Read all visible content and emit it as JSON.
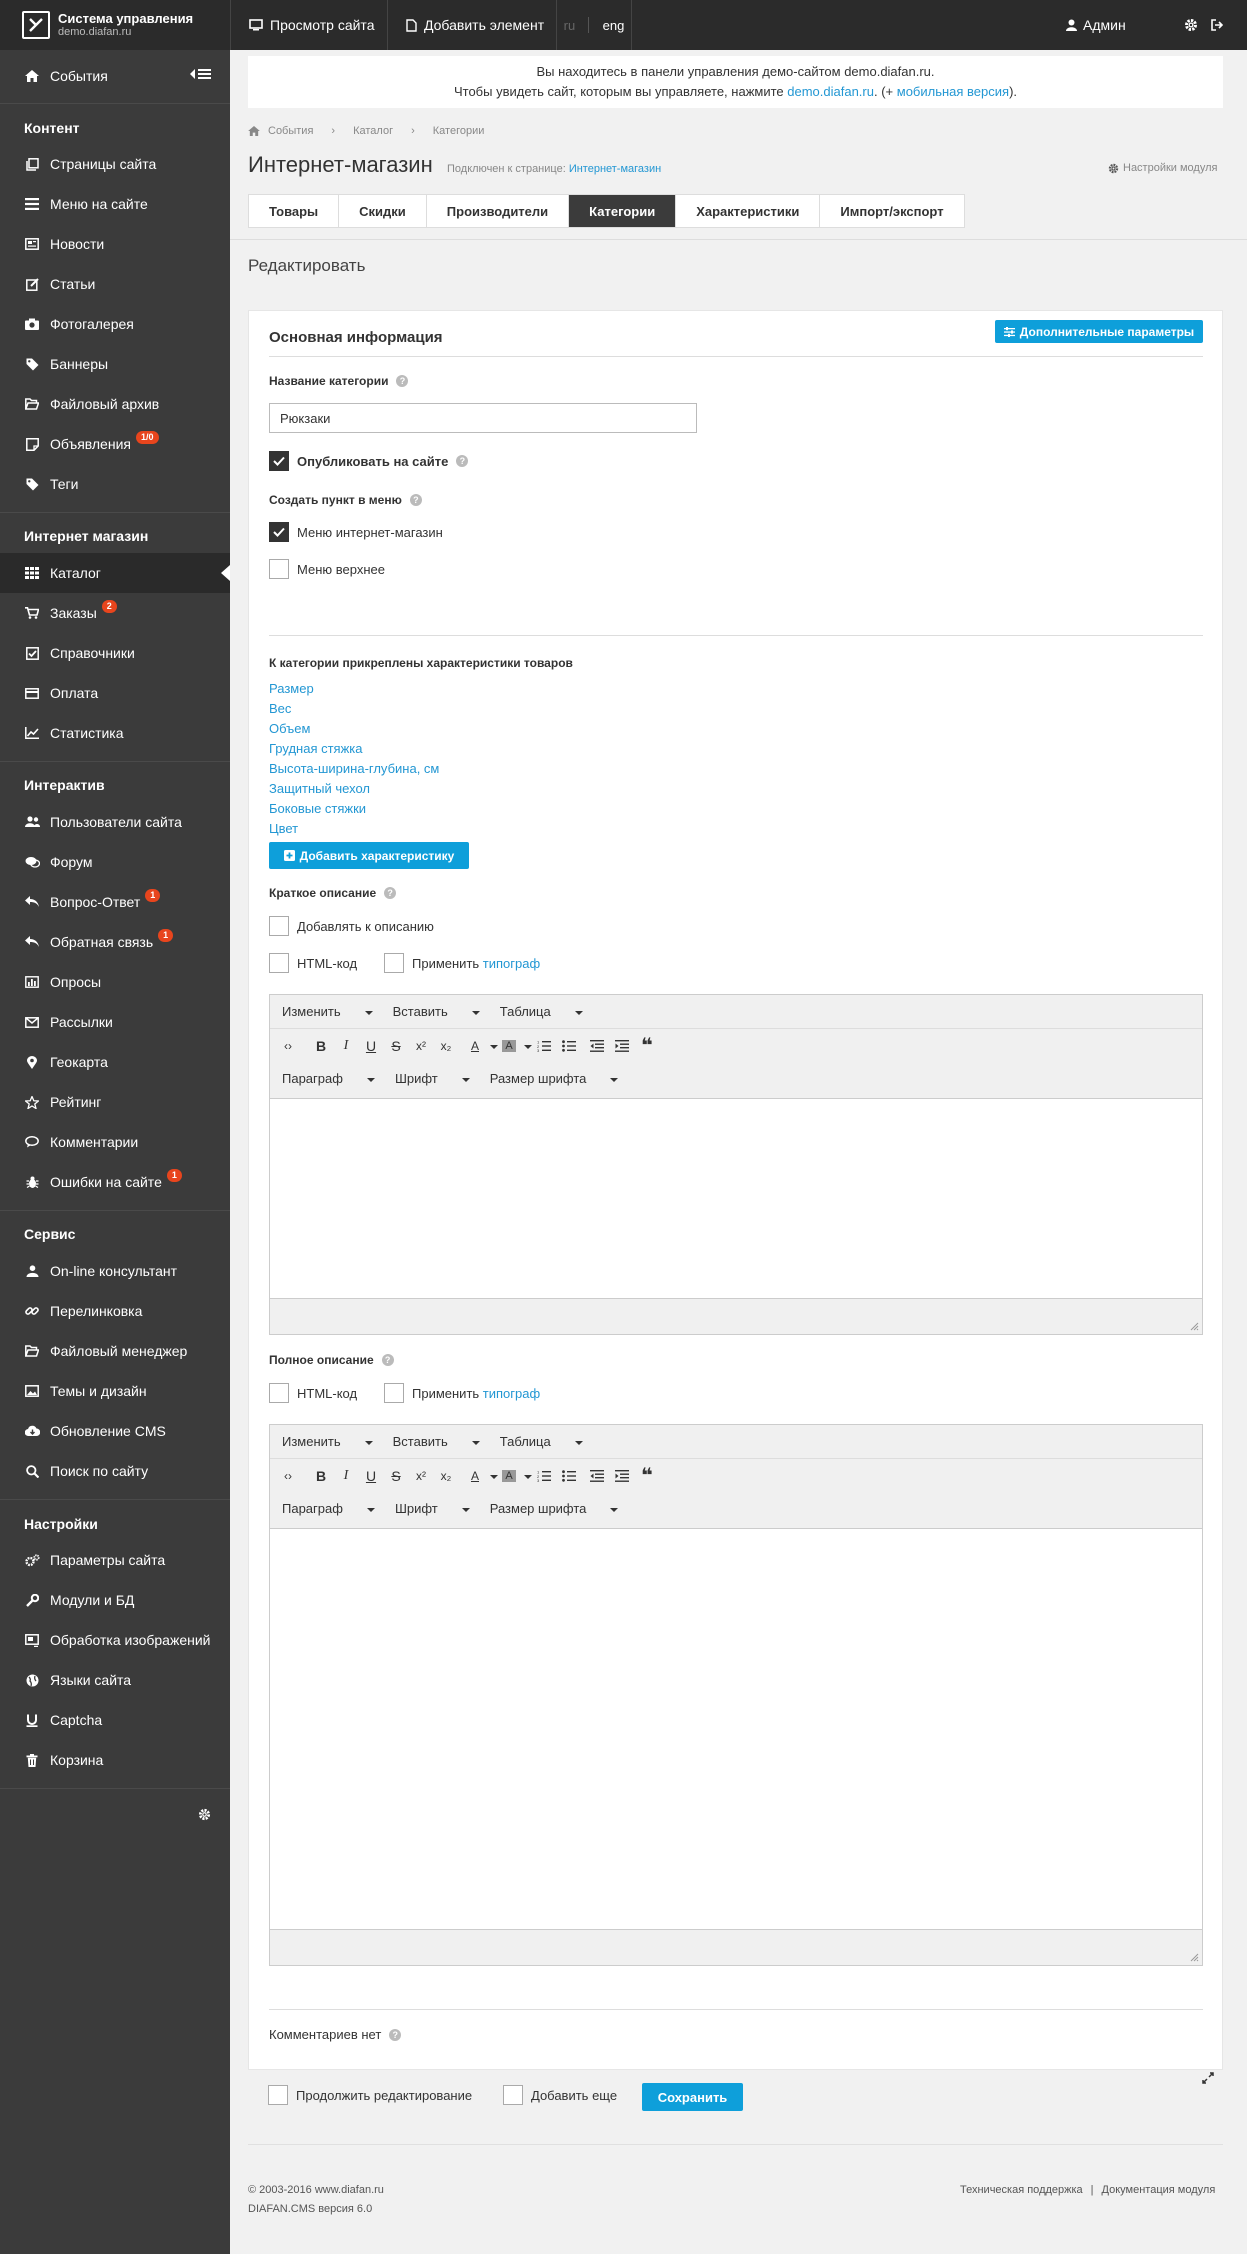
{
  "topbar": {
    "brand_title": "Система управления",
    "brand_sub": "demo.diafan.ru",
    "view_site": "Просмотр сайта",
    "add_element": "Добавить элемент",
    "lang_ru": "ru",
    "lang_eng": "eng",
    "admin": "Админ"
  },
  "sidebar": {
    "events": "События",
    "sections": {
      "content": "Контент",
      "shop": "Интернет магазин",
      "interactive": "Интерактив",
      "service": "Сервис",
      "settings": "Настройки"
    },
    "items": {
      "pages": "Страницы сайта",
      "menu": "Меню на сайте",
      "news": "Новости",
      "articles": "Статьи",
      "photo": "Фотогалерея",
      "banners": "Баннеры",
      "files": "Файловый архив",
      "ads": "Объявления",
      "ads_badge": "1/0",
      "tags": "Теги",
      "catalog": "Каталог",
      "orders": "Заказы",
      "orders_badge": "2",
      "refs": "Справочники",
      "payment": "Оплата",
      "stats": "Статистика",
      "users": "Пользователи сайта",
      "forum": "Форум",
      "faq": "Вопрос-Ответ",
      "faq_badge": "1",
      "feedback": "Обратная связь",
      "feedback_badge": "1",
      "votes": "Опросы",
      "mailing": "Рассылки",
      "geomap": "Геокарта",
      "rating": "Рейтинг",
      "comments": "Комментарии",
      "errors": "Ошибки на сайте",
      "errors_badge": "1",
      "consultant": "On-line консультант",
      "relinking": "Перелинковка",
      "filemanager": "Файловый менеджер",
      "themes": "Темы и дизайн",
      "update": "Обновление CMS",
      "search": "Поиск по сайту",
      "site_params": "Параметры сайта",
      "modules": "Модули и БД",
      "images": "Обработка изображений",
      "languages": "Языки сайта",
      "captcha": "Captcha",
      "trash": "Корзина"
    }
  },
  "notice": {
    "line1": "Вы находитесь в панели управления демо-сайтом demo.diafan.ru.",
    "line2_pre": "Чтобы увидеть сайт, которым вы управляете, нажмите ",
    "line2_link": "demo.diafan.ru",
    "line2_mid": ". (+ ",
    "line2_mobile": "мобильная версия",
    "line2_end": ")."
  },
  "breadcrumbs": [
    "События",
    "Каталог",
    "Категории"
  ],
  "page": {
    "title": "Интернет-магазин",
    "linked_pre": "Подключен к странице: ",
    "linked_link": "Интернет-магазин",
    "module_settings": "Настройки модуля",
    "subtitle": "Редактировать"
  },
  "tabs": [
    "Товары",
    "Скидки",
    "Производители",
    "Категории",
    "Характеристики",
    "Импорт/экспорт"
  ],
  "form": {
    "main_info": "Основная информация",
    "extra_params": "Дополнительные параметры",
    "category_name_label": "Название категории",
    "category_name_value": "Рюкзаки",
    "publish": "Опубликовать на сайте",
    "create_menu": "Создать пункт в меню",
    "menu_shop": "Меню интернет-магазин",
    "menu_top": "Меню верхнее",
    "features_title": "К категории прикреплены характеристики товаров",
    "features": [
      "Размер",
      "Вес",
      "Объем",
      "Грудная стяжка",
      "Высота-ширина-глубина, см",
      "Защитный чехол",
      "Боковые стяжки",
      "Цвет"
    ],
    "add_feature": "Добавить характеристику",
    "short_desc": "Краткое описание",
    "add_to_desc": "Добавлять к описанию",
    "html_code": "HTML-код",
    "apply": "Применить ",
    "typograph": "типограф",
    "full_desc": "Полное описание",
    "comments_none": "Комментариев нет"
  },
  "editor": {
    "menu": [
      "Изменить",
      "Вставить",
      "Таблица"
    ],
    "format": [
      "Параграф",
      "Шрифт",
      "Размер шрифта"
    ]
  },
  "bottom": {
    "continue_edit": "Продолжить редактирование",
    "add_more": "Добавить еще",
    "save": "Сохранить"
  },
  "footer": {
    "copyright": "© 2003-2016 www.diafan.ru",
    "version": "DIAFAN.CMS версия 6.0",
    "support": "Техническая поддержка",
    "sep": "|",
    "docs": "Документация модуля"
  }
}
